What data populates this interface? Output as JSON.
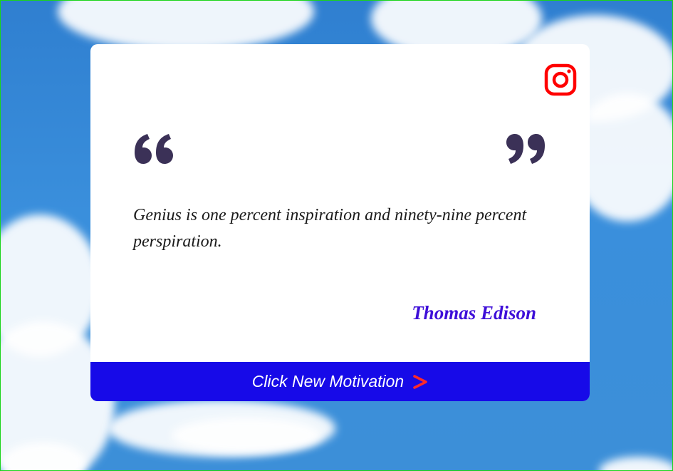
{
  "quote": {
    "text": "Genius is one percent inspiration and ninety-nine percent perspiration.",
    "author": "Thomas Edison"
  },
  "button": {
    "label": "Click New Motivation",
    "chevron_icon": "chevron-right-icon"
  },
  "icons": {
    "social": "instagram-icon",
    "open_quote": "open-quote-icon",
    "close_quote": "close-quote-icon"
  },
  "colors": {
    "button_bg": "#170ae8",
    "author": "#3e0fd8",
    "quote_marks": "#3b3157",
    "instagram": "#ff0000",
    "chevron": "#ff2a2a"
  }
}
